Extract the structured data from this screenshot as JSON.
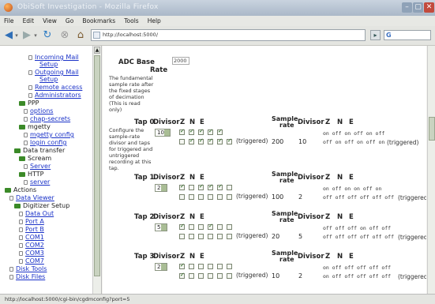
{
  "window": {
    "title": "ObiSoft Investigation - Mozilla Firefox"
  },
  "menu": [
    "File",
    "Edit",
    "View",
    "Go",
    "Bookmarks",
    "Tools",
    "Help"
  ],
  "toolbar": {
    "url": "http://localhost:5000/",
    "search_glyph": "G"
  },
  "sidebar": {
    "items": [
      {
        "label": "Incoming Mail",
        "kind": "leaf"
      },
      {
        "label": "Setup",
        "kind": "cont"
      },
      {
        "label": "Outgoing Mail",
        "kind": "leaf"
      },
      {
        "label": "Setup",
        "kind": "cont"
      },
      {
        "label": "Remote access",
        "kind": "leaf"
      },
      {
        "label": "Administrators",
        "kind": "leaf"
      },
      {
        "label": "PPP",
        "kind": "folder"
      },
      {
        "label": "options",
        "kind": "leaf"
      },
      {
        "label": "chap-secrets",
        "kind": "leaf"
      },
      {
        "label": "mgetty",
        "kind": "folder"
      },
      {
        "label": "mgetty config",
        "kind": "leaf"
      },
      {
        "label": "login config",
        "kind": "leaf"
      },
      {
        "label": "Data transfer",
        "kind": "folder"
      },
      {
        "label": "Scream",
        "kind": "folder"
      },
      {
        "label": "Server",
        "kind": "leaf"
      },
      {
        "label": "HTTP",
        "kind": "folder"
      },
      {
        "label": "server",
        "kind": "leaf"
      },
      {
        "label": "Actions",
        "kind": "folder"
      },
      {
        "label": "Data Viewer",
        "kind": "leaf"
      },
      {
        "label": "Digitizer Setup",
        "kind": "folder"
      },
      {
        "label": "Data Out",
        "kind": "leaf"
      },
      {
        "label": "Port A",
        "kind": "leaf"
      },
      {
        "label": "Port B",
        "kind": "leaf"
      },
      {
        "label": "COM1",
        "kind": "leaf"
      },
      {
        "label": "COM2",
        "kind": "leaf"
      },
      {
        "label": "COM3",
        "kind": "leaf"
      },
      {
        "label": "COM7",
        "kind": "leaf"
      },
      {
        "label": "Disk Tools",
        "kind": "leaf"
      },
      {
        "label": "Disk Files",
        "kind": "leaf"
      }
    ]
  },
  "main": {
    "adc": {
      "label_line1": "ADC Base",
      "label_line2": "Rate",
      "value": "2000",
      "description": [
        "The fundamental",
        "sample rate after",
        "the fixed stages",
        "of decimation",
        "(This is read",
        "only)"
      ]
    },
    "tap0_description": [
      "Configure the",
      "sample-rate",
      "divisor and taps",
      "for triggered and",
      "untriggered",
      "recording at this",
      "tap."
    ],
    "col_divisor": "Divisor",
    "col_z": "Z",
    "col_n": "N",
    "col_e": "E",
    "col_sample": "Sample",
    "col_rate": "rate",
    "triggered": "(triggered)",
    "taps": [
      {
        "label": "Tap 0",
        "divisor": "10",
        "rate": "200",
        "out_divisor": "10",
        "row1": [
          true,
          true,
          true,
          true,
          true,
          false
        ],
        "row2": [
          false,
          true,
          true,
          true,
          true,
          true
        ],
        "out1": "on  off on  off on  off",
        "out2": "off on  off on  off on"
      },
      {
        "label": "Tap 1",
        "divisor": "2",
        "rate": "100",
        "out_divisor": "2",
        "row1": [
          true,
          false,
          true,
          true,
          true,
          false
        ],
        "row2": [
          false,
          false,
          false,
          false,
          false,
          false
        ],
        "out1": "on  off on  on  off on",
        "out2": "off off off off off off"
      },
      {
        "label": "Tap 2",
        "divisor": "5",
        "rate": "20",
        "out_divisor": "5",
        "row1": [
          true,
          false,
          false,
          true,
          false,
          false
        ],
        "row2": [
          false,
          false,
          false,
          false,
          false,
          false
        ],
        "out1": "off off off on  off off",
        "out2": "off off off off off off"
      },
      {
        "label": "Tap 3",
        "divisor": "2",
        "rate": "10",
        "out_divisor": "2",
        "row1": [
          true,
          false,
          false,
          false,
          false,
          false
        ],
        "row2": [
          true,
          false,
          false,
          false,
          false,
          false
        ],
        "out1": "on  off off off off off",
        "out2": "on  off off off off off"
      }
    ]
  },
  "status": {
    "text": "http://localhost:5000/cgi-bin/cgdmconfig?port=5"
  }
}
